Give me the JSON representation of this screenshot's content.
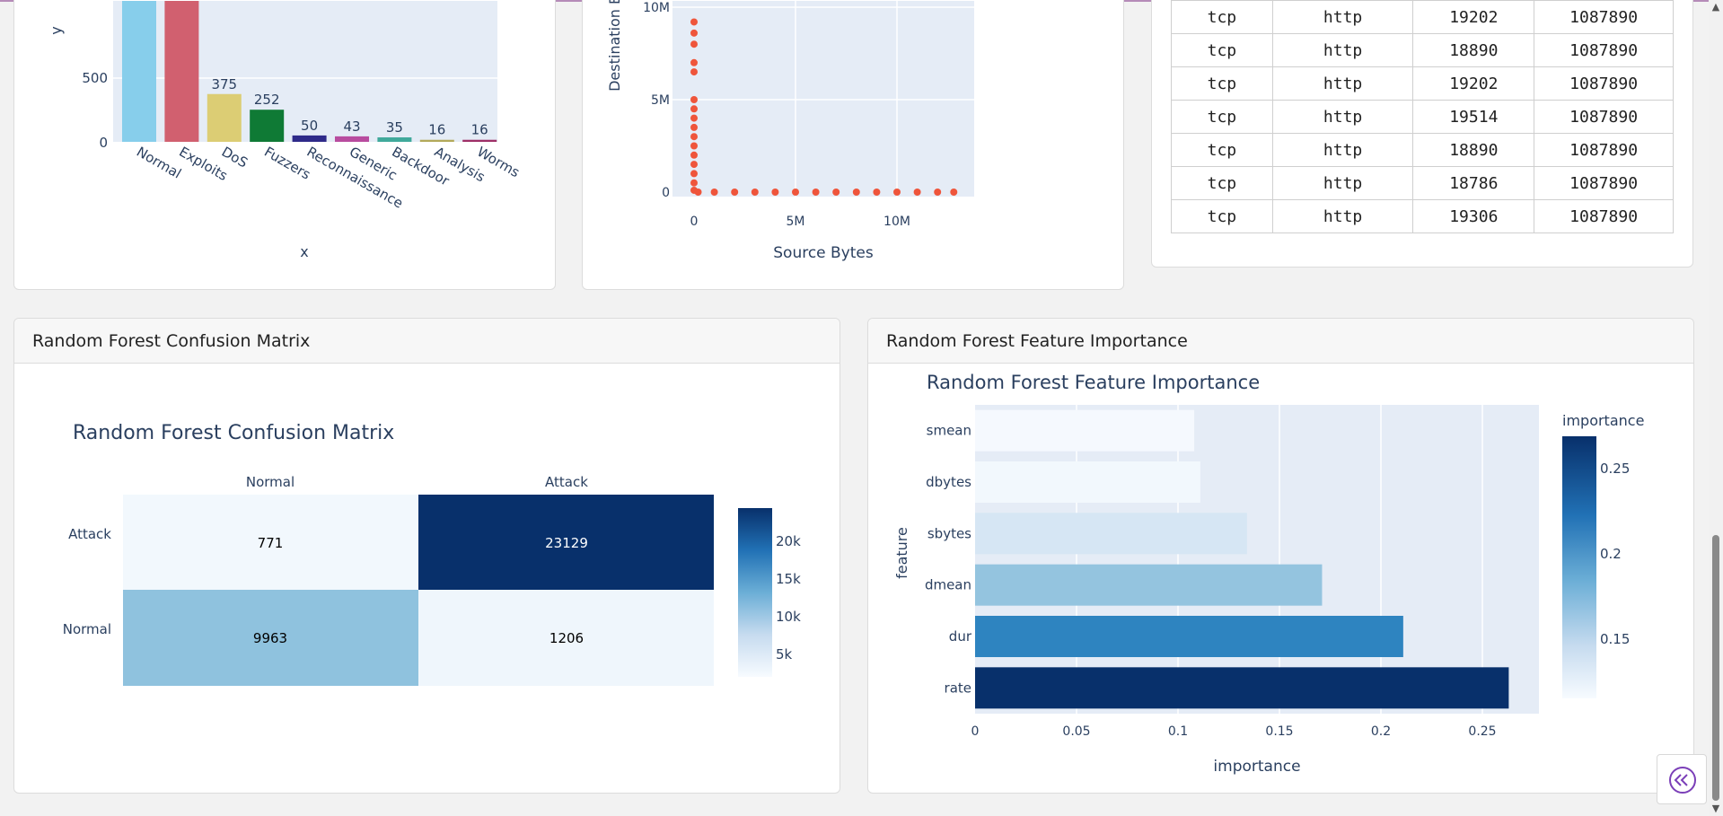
{
  "bar_chart": {
    "y_axis_label": "y",
    "x_axis_label": "x",
    "y_ticks": [
      "500",
      "0"
    ],
    "bar_colors": [
      "#87ceeb",
      "#d1606f",
      "#dccd74",
      "#0f7a35",
      "#2e2a89",
      "#b84c9f",
      "#40a99b",
      "#b3a95a",
      "#9e2f67"
    ],
    "chart_data": {
      "type": "bar",
      "categories": [
        "Normal",
        "Exploits",
        "DoS",
        "Fuzzers",
        "Reconnaissance",
        "Generic",
        "Backdoor",
        "Analysis",
        "Worms"
      ],
      "values": [
        null,
        null,
        375,
        252,
        50,
        43,
        35,
        16,
        16
      ],
      "value_labels": [
        "",
        "",
        "375",
        "252",
        "50",
        "43",
        "35",
        "16",
        "16"
      ],
      "xlabel": "x",
      "ylabel": "y",
      "note": ""
    }
  },
  "scatter_chart": {
    "y_axis_label": "Destination Bytes",
    "x_axis_label": "Source Bytes",
    "y_ticks": [
      "10M",
      "5M",
      "0"
    ],
    "x_ticks": [
      "0",
      "5M",
      "10M"
    ],
    "point_color": "#ef553b",
    "chart_data": {
      "type": "scatter",
      "xlabel": "Source Bytes",
      "ylabel": "Destination Bytes",
      "points_near_y_axis": [
        [
          0,
          9200000
        ],
        [
          0,
          8600000
        ],
        [
          0,
          8000000
        ],
        [
          0,
          7000000
        ],
        [
          0,
          6500000
        ],
        [
          0,
          5000000
        ],
        [
          0,
          4500000
        ],
        [
          0,
          4000000
        ],
        [
          0,
          3500000
        ],
        [
          0,
          3000000
        ],
        [
          0,
          2500000
        ],
        [
          0,
          2000000
        ],
        [
          0,
          1500000
        ],
        [
          0,
          1000000
        ],
        [
          0,
          500000
        ],
        [
          0,
          100000
        ]
      ],
      "points_near_x_axis": [
        [
          200000,
          0
        ],
        [
          1000000,
          0
        ],
        [
          2000000,
          0
        ],
        [
          3000000,
          0
        ],
        [
          4000000,
          0
        ],
        [
          5000000,
          0
        ],
        [
          6000000,
          0
        ],
        [
          7000000,
          0
        ],
        [
          8000000,
          0
        ],
        [
          9000000,
          0
        ],
        [
          10000000,
          0
        ],
        [
          11000000,
          0
        ],
        [
          12000000,
          0
        ],
        [
          12800000,
          0
        ]
      ]
    }
  },
  "data_table": {
    "rows": [
      [
        "tcp",
        "http",
        "19202",
        "1087890"
      ],
      [
        "tcp",
        "http",
        "18890",
        "1087890"
      ],
      [
        "tcp",
        "http",
        "19202",
        "1087890"
      ],
      [
        "tcp",
        "http",
        "19514",
        "1087890"
      ],
      [
        "tcp",
        "http",
        "18890",
        "1087890"
      ],
      [
        "tcp",
        "http",
        "18786",
        "1087890"
      ],
      [
        "tcp",
        "http",
        "19306",
        "1087890"
      ]
    ]
  },
  "confusion_card": {
    "header": "Random Forest Confusion Matrix",
    "chart_title": "Random Forest Confusion Matrix",
    "colorbar_ticks": [
      "20k",
      "15k",
      "10k",
      "5k"
    ],
    "chart_data": {
      "type": "heatmap",
      "x": [
        "Normal",
        "Attack"
      ],
      "y": [
        "Attack",
        "Normal"
      ],
      "z": [
        [
          771,
          23129
        ],
        [
          9963,
          1206
        ]
      ],
      "cell_colors": [
        [
          "#f2f8fd",
          "#08306b"
        ],
        [
          "#8fc2de",
          "#eff6fc"
        ]
      ],
      "colorscale": "Blues"
    }
  },
  "feature_card": {
    "header": "Random Forest Feature Importance",
    "chart_title": "Random Forest Feature Importance",
    "colorbar_title": "importance",
    "colorbar_ticks": [
      "0.25",
      "0.2",
      "0.15"
    ],
    "chart_data": {
      "type": "bar",
      "orientation": "horizontal",
      "categories": [
        "smean",
        "dbytes",
        "sbytes",
        "dmean",
        "dur",
        "rate"
      ],
      "values": [
        0.108,
        0.111,
        0.134,
        0.171,
        0.211,
        0.263
      ],
      "bar_colors": [
        "#f5f9fe",
        "#f2f8fd",
        "#d6e6f4",
        "#94c4df",
        "#2e84c0",
        "#08306b"
      ],
      "xlabel": "importance",
      "ylabel": "feature",
      "x_ticks": [
        "0",
        "0.05",
        "0.1",
        "0.15",
        "0.2",
        "0.25"
      ],
      "xlim": [
        0,
        0.28
      ]
    }
  }
}
